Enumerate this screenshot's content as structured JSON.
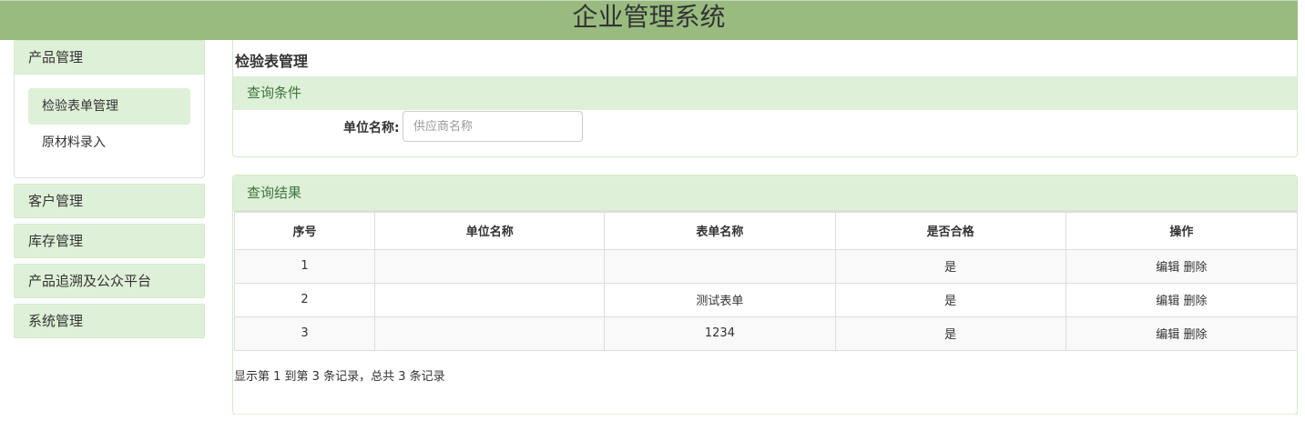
{
  "app": {
    "title": "企业管理系统"
  },
  "sidebar": {
    "groups": [
      {
        "label": "产品管理",
        "items": [
          {
            "label": "检验表单管理"
          },
          {
            "label": "原材料录入"
          }
        ]
      },
      {
        "label": "客户管理"
      },
      {
        "label": "库存管理"
      },
      {
        "label": "产品追溯及公众平台"
      },
      {
        "label": "系统管理"
      }
    ]
  },
  "main": {
    "page_title": "检验表管理",
    "query": {
      "heading": "查询条件",
      "label": "单位名称:",
      "placeholder": "供应商名称",
      "value": ""
    },
    "result": {
      "heading": "查询结果",
      "columns": [
        "序号",
        "单位名称",
        "表单名称",
        "是否合格",
        "操作"
      ],
      "rows": [
        {
          "no": "1",
          "unit": "",
          "form": "",
          "qualified": "是",
          "edit": "编辑",
          "delete": "删除"
        },
        {
          "no": "2",
          "unit": "",
          "form": "测试表单",
          "qualified": "是",
          "edit": "编辑",
          "delete": "删除"
        },
        {
          "no": "3",
          "unit": "",
          "form": "1234",
          "qualified": "是",
          "edit": "编辑",
          "delete": "删除"
        }
      ],
      "summary": "显示第 1 到第 3 条记录，总共 3 条记录"
    }
  },
  "colors": {
    "header_bg": "#99bb80",
    "panel_head_bg": "#dff0d8",
    "panel_head_text": "#3c763d"
  }
}
